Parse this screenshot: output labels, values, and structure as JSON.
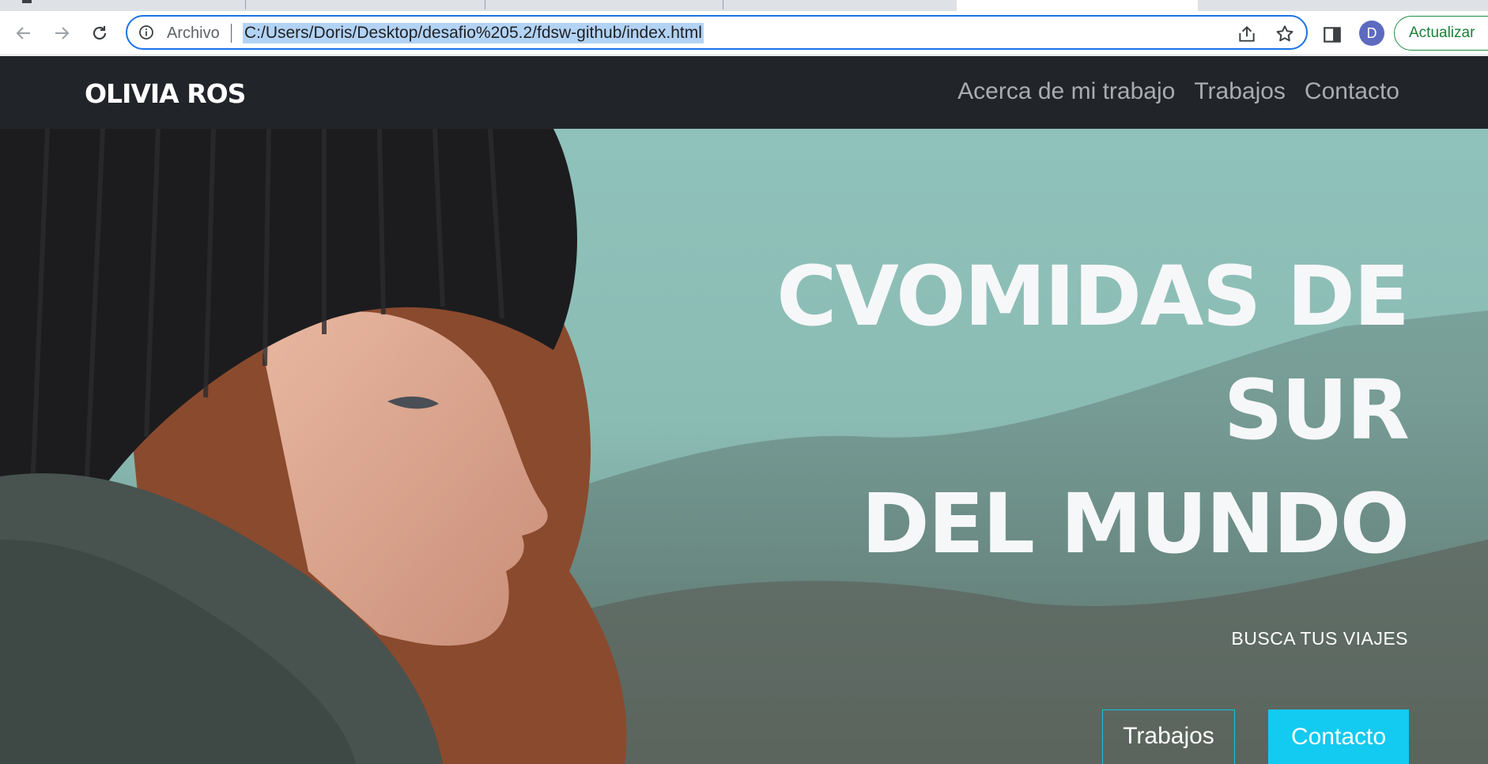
{
  "browser": {
    "address_scheme": "Archivo",
    "address_url": "C:/Users/Doris/Desktop/desafio%205.2/fdsw-github/index.html",
    "profile_initial": "D",
    "update_button": "Actualizar"
  },
  "site": {
    "brand": "OLIVIA ROS",
    "nav": [
      {
        "label": "Acerca de mi trabajo"
      },
      {
        "label": "Trabajos"
      },
      {
        "label": "Contacto"
      }
    ],
    "hero": {
      "title_lines": [
        "CVOMIDAS DE",
        "SUR",
        "DEL MUNDO"
      ],
      "subtitle": "BUSCA TUS VIAJES",
      "primary_button": "Trabajos",
      "secondary_button": "Contacto"
    }
  },
  "colors": {
    "navbar_bg": "#212529",
    "accent_cyan": "#13caf0",
    "omnibox_border": "#1a73e8",
    "update_green": "#188038"
  },
  "icons": [
    "back-icon",
    "forward-icon",
    "reload-icon",
    "info-icon",
    "share-icon",
    "star-icon",
    "side-panel-icon"
  ]
}
